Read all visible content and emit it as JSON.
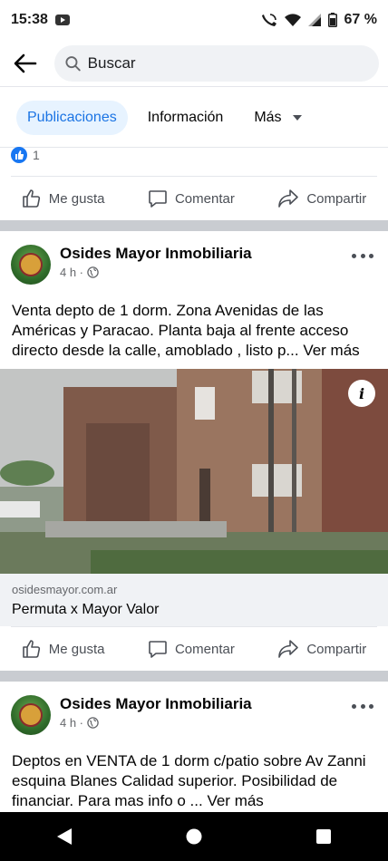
{
  "status": {
    "time": "15:38",
    "battery": "67 %"
  },
  "search": {
    "placeholder": "Buscar"
  },
  "tabs": [
    {
      "label": "Publicaciones"
    },
    {
      "label": "Información"
    },
    {
      "label": "Más"
    }
  ],
  "previous_post": {
    "reaction_count": "1"
  },
  "actions": {
    "like": "Me gusta",
    "comment": "Comentar",
    "share": "Compartir"
  },
  "posts": [
    {
      "page_name": "Osides Mayor Inmobiliaria",
      "time": "4 h ·",
      "text": "Venta depto de 1 dorm.  Zona Avenidas de las Américas y Paracao.  Planta baja al frente acceso directo desde la calle,  amoblado , listo p...",
      "see_more": "Ver más",
      "link_domain": "osidesmayor.com.ar",
      "link_title": "Permuta x Mayor Valor"
    },
    {
      "page_name": "Osides Mayor Inmobiliaria",
      "time": "4 h ·",
      "text": "Deptos  en VENTA de 1 dorm c/patio sobre  Av Zanni esquina Blanes Calidad superior. Posibilidad de financiar. Para mas info o ...",
      "see_more": "Ver más"
    }
  ],
  "colors": {
    "accent": "#1877f2",
    "tab_active_bg": "#e7f3ff",
    "separator": "#c9ccd1"
  }
}
